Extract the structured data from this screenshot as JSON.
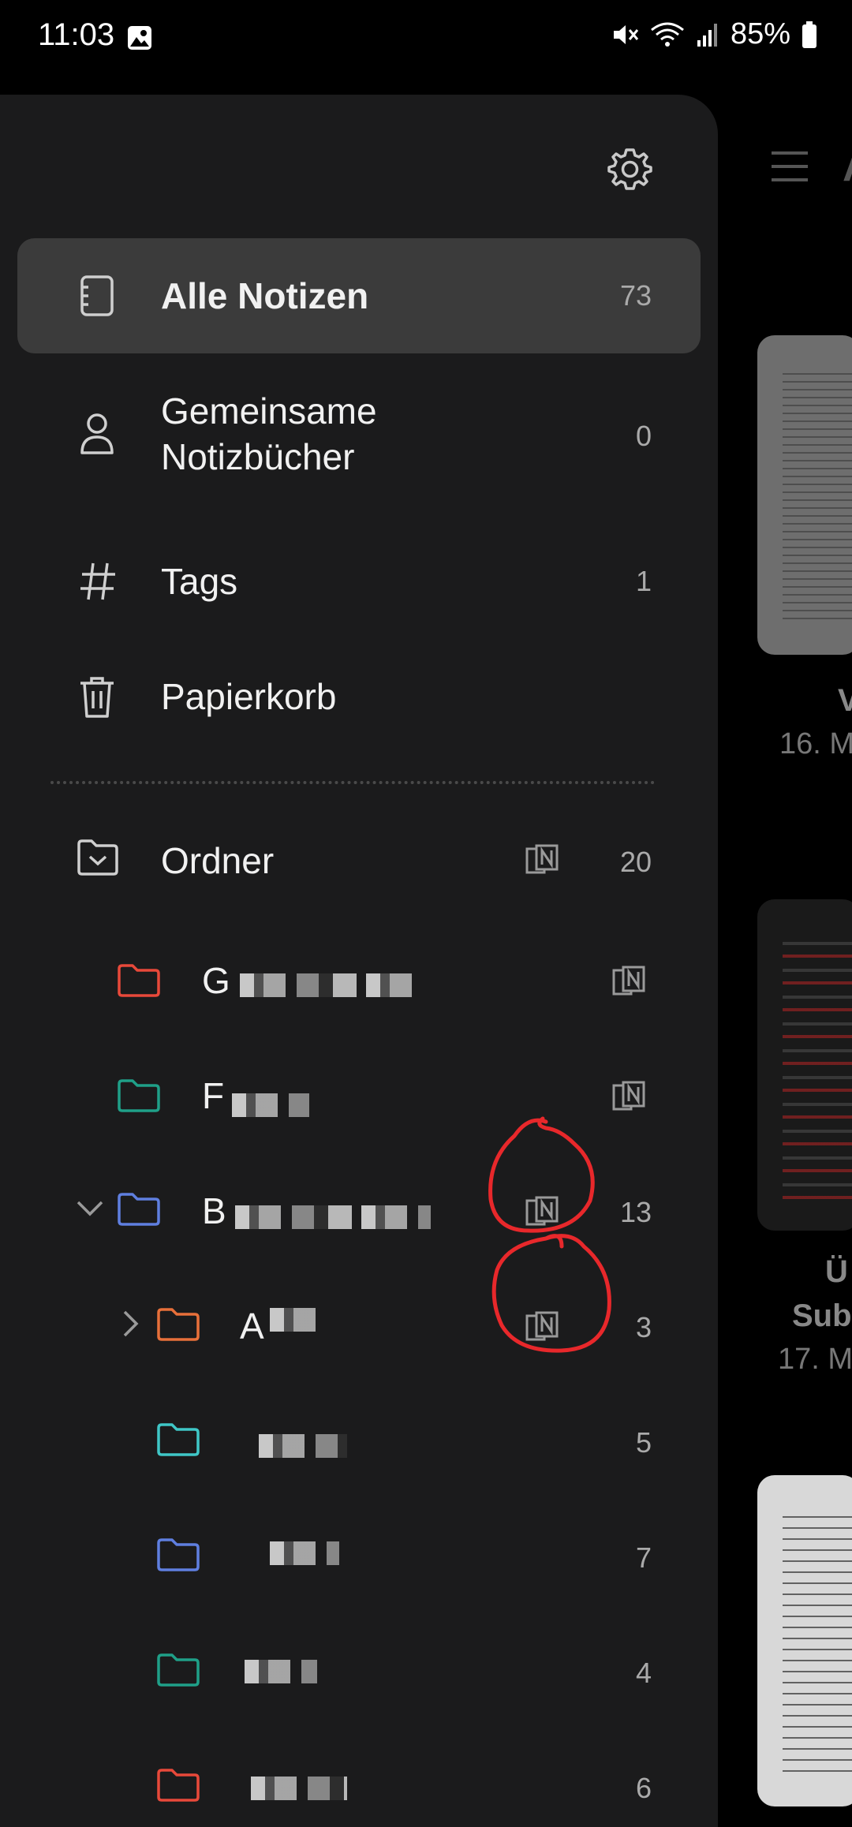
{
  "status_bar": {
    "time": "11:03",
    "battery": "85%"
  },
  "drawer": {
    "items": [
      {
        "label": "Alle Notizen",
        "count": "73",
        "active": true
      },
      {
        "label_line1": "Gemeinsame",
        "label_line2": "Notizbücher",
        "count": "0"
      },
      {
        "label": "Tags",
        "count": "1"
      },
      {
        "label": "Papierkorb"
      }
    ],
    "folders_header": {
      "label": "Ordner",
      "count": "20"
    },
    "folders": [
      {
        "label": "G",
        "color": "#e8493a",
        "onenote": true,
        "count": ""
      },
      {
        "label": "F",
        "color": "#1fa088",
        "onenote": true,
        "count": ""
      },
      {
        "label": "B",
        "color": "#5f7fe0",
        "onenote": true,
        "count": "13",
        "expanded": true
      },
      {
        "label": "A",
        "color": "#e8703a",
        "onenote": true,
        "count": "3",
        "collapsed": true
      },
      {
        "label": "",
        "color": "#3fc7c7",
        "count": "5"
      },
      {
        "label": "",
        "color": "#5f7fe0",
        "count": "7"
      },
      {
        "label": "",
        "color": "#1fa088",
        "count": "4"
      },
      {
        "label": "",
        "color": "#e8493a",
        "count": "6"
      }
    ]
  },
  "background": {
    "header_letter": "A",
    "card1_title": "V",
    "card1_date": "16. M",
    "card2_title1": "Ü",
    "card2_title2": "Sub",
    "card2_date": "17. M"
  }
}
